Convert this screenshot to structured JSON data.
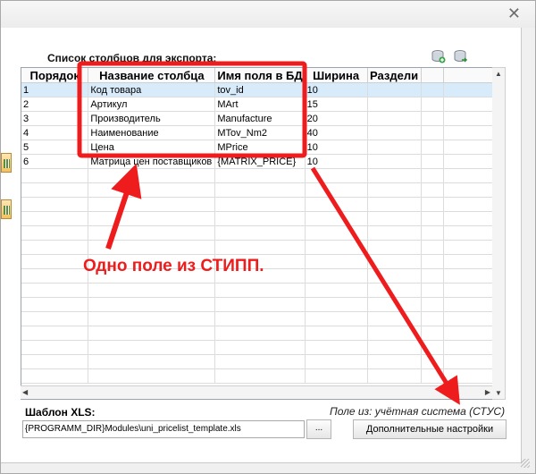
{
  "window": {
    "close_glyph": "✕"
  },
  "export": {
    "list_label": "Список столбцов для экспорта:",
    "toolbar_icons": [
      "add-db-icon",
      "export-db-icon"
    ],
    "columns": [
      "Порядок",
      "Название столбца",
      "Имя поля в БД",
      "Ширина",
      "Раздели"
    ],
    "rows": [
      [
        "1",
        "Код товара",
        "tov_id",
        "10",
        ""
      ],
      [
        "2",
        "Артикул",
        "MArt",
        "15",
        ""
      ],
      [
        "3",
        "Производитель",
        "Manufacture",
        "20",
        ""
      ],
      [
        "4",
        "Наименование",
        "MTov_Nm2",
        "40",
        ""
      ],
      [
        "5",
        "Цена",
        "MPrice",
        "10",
        ""
      ],
      [
        "6",
        "Матрица цен поставщиков",
        "{MATRIX_PRICE}",
        "10",
        ""
      ]
    ]
  },
  "template": {
    "label": "Шаблон XLS:",
    "path": "{PROGRAMM_DIR}Modules\\uni_pricelist_template.xls",
    "browse_label": "...",
    "field_source": "Поле из:  учётная система (СТУС)",
    "more_settings": "Дополнительные настройки"
  },
  "annotation": {
    "text": "Одно поле из СТИПП.",
    "color": "#ee1c1c"
  }
}
